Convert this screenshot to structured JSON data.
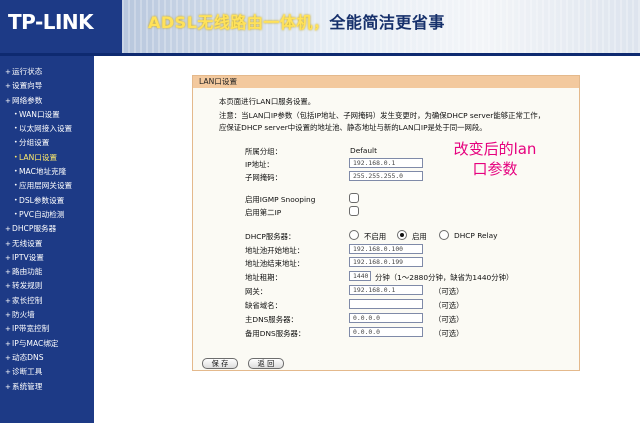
{
  "header": {
    "logo": "TP-LINK",
    "banner_highlight": "ADSL无线路由一体机，",
    "banner_rest": "全能简洁更省事"
  },
  "sidebar": {
    "items": [
      {
        "label": "运行状态",
        "level": 1
      },
      {
        "label": "设置向导",
        "level": 1
      },
      {
        "label": "网络参数",
        "level": 1
      },
      {
        "label": "WAN口设置",
        "level": 2
      },
      {
        "label": "以太网接入设置",
        "level": 2
      },
      {
        "label": "分组设置",
        "level": 2
      },
      {
        "label": "LAN口设置",
        "level": 2,
        "active": true
      },
      {
        "label": "MAC地址克隆",
        "level": 2
      },
      {
        "label": "应用层网关设置",
        "level": 2
      },
      {
        "label": "DSL参数设置",
        "level": 2
      },
      {
        "label": "PVC自动检测",
        "level": 2
      },
      {
        "label": "DHCP服务器",
        "level": 1
      },
      {
        "label": "无线设置",
        "level": 1
      },
      {
        "label": "IPTV设置",
        "level": 1
      },
      {
        "label": "路由功能",
        "level": 1
      },
      {
        "label": "转发规则",
        "level": 1
      },
      {
        "label": "家长控制",
        "level": 1
      },
      {
        "label": "防火墙",
        "level": 1
      },
      {
        "label": "IP带宽控制",
        "level": 1
      },
      {
        "label": "IP与MAC绑定",
        "level": 1
      },
      {
        "label": "动态DNS",
        "level": 1
      },
      {
        "label": "诊断工具",
        "level": 1
      },
      {
        "label": "系统管理",
        "level": 1
      }
    ]
  },
  "panel": {
    "title": "LAN口设置",
    "intro_line1": "本页面进行LAN口服务设置。",
    "intro_line2": "注意：当LAN口IP参数（包括IP地址、子网掩码）发生变更时，为确保DHCP server能够正常工作，",
    "intro_line3": "应保证DHCP server中设置的地址池、静态地址与新的LAN口IP是处于同一网段。"
  },
  "form": {
    "group_label": "所属分组：",
    "group_value": "Default",
    "ip_label": "IP地址：",
    "ip_value": "192.168.0.1",
    "mask_label": "子网掩码：",
    "mask_value": "255.255.255.0",
    "igmp_label": "启用IGMP Snooping",
    "second_ip_label": "启用第二IP",
    "dhcp_label": "DHCP服务器：",
    "dhcp_options": [
      "不启用",
      "启用",
      "DHCP Relay"
    ],
    "dhcp_selected": "启用",
    "pool_start_label": "地址池开始地址：",
    "pool_start_value": "192.168.0.100",
    "pool_end_label": "地址池结束地址：",
    "pool_end_value": "192.168.0.199",
    "lease_label": "地址租期：",
    "lease_value": "1440",
    "lease_suffix": "分钟（1～2880分钟，缺省为1440分钟）",
    "gateway_label": "网关：",
    "gateway_value": "192.168.0.1",
    "domain_label": "缺省域名：",
    "domain_value": "",
    "dns1_label": "主DNS服务器：",
    "dns1_value": "0.0.0.0",
    "dns2_label": "备用DNS服务器：",
    "dns2_value": "0.0.0.0",
    "optional": "（可选）"
  },
  "annotation": {
    "line1": "改变后的lan",
    "line2": "口参数",
    "color": "#e6007e"
  },
  "buttons": {
    "save": "保 存",
    "back": "返 回"
  }
}
